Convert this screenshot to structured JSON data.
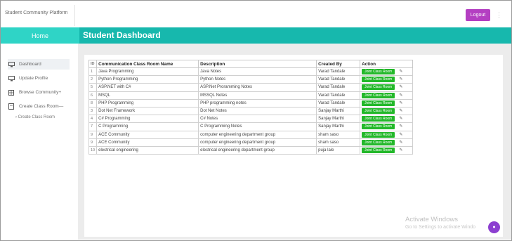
{
  "topbar": {
    "brand": "Student Community Platform",
    "logout_label": "Logout",
    "menu_icon": "kebab-icon"
  },
  "nav": {
    "home_label": "Home",
    "page_title": "Student Dashboard"
  },
  "sidebar": {
    "items": [
      {
        "label": "Dashboard",
        "icon": "monitor-icon"
      },
      {
        "label": "Update Profile",
        "icon": "monitor-icon"
      },
      {
        "label": "Browse Community+",
        "icon": "grid-icon"
      },
      {
        "label": "Create Class Room—",
        "icon": "book-icon"
      }
    ],
    "sub_item": "Create Class Room"
  },
  "table": {
    "headers": [
      "ID",
      "Communication Class Room Name",
      "Description",
      "Created By",
      "Action"
    ],
    "action_label": "Joint Class Room",
    "rows": [
      {
        "id": "1",
        "name": "Java Programming",
        "desc": "Java Notes",
        "by": "Varad Tandale"
      },
      {
        "id": "2",
        "name": "Python Programming",
        "desc": "Python Notes",
        "by": "Varad Tandale"
      },
      {
        "id": "5",
        "name": "ASP.NET with C#",
        "desc": "ASP.Net Proramming Notes",
        "by": "Varad Tandale"
      },
      {
        "id": "6",
        "name": "MSQL",
        "desc": "MSSQL Notes",
        "by": "Varad Tandale"
      },
      {
        "id": "8",
        "name": "PHP Programming",
        "desc": "PHP programming notes",
        "by": "Varad Tandale"
      },
      {
        "id": "3",
        "name": "Dot Net Framework",
        "desc": "Dot Net Notes",
        "by": "Sanjay Marthi"
      },
      {
        "id": "4",
        "name": "C# Programming",
        "desc": "C# Notes",
        "by": "Sanjay Marthi"
      },
      {
        "id": "7",
        "name": "C Programming",
        "desc": "C Programming Notes",
        "by": "Sanjay Marthi"
      },
      {
        "id": "9",
        "name": "ACE Community",
        "desc": "computer engineering department group",
        "by": "sham saso"
      },
      {
        "id": "9",
        "name": "ACE Community",
        "desc": "computer engineering department group",
        "by": "sham saso"
      },
      {
        "id": "10",
        "name": "electrical engineering",
        "desc": "electrical engineering department group",
        "by": "puja lale"
      }
    ]
  },
  "watermark": {
    "line1": "Activate Windows",
    "line2": "Go to Settings to activate Windo"
  },
  "colors": {
    "accent": "#b43fc2",
    "teal": "#17b8ad",
    "teal_light": "#2fd4c6",
    "join_green": "#23b82a",
    "fab": "#8c3fd0"
  }
}
